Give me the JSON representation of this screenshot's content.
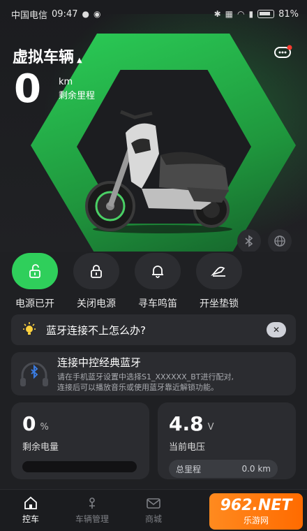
{
  "status_bar": {
    "carrier": "中国电信",
    "time": "09:47",
    "battery": "81%"
  },
  "vehicle": {
    "name": "虚拟车辆",
    "range_value": "0",
    "range_unit": "km",
    "range_label": "剩余里程"
  },
  "controls": [
    {
      "label": "电源已开",
      "icon": "unlock-icon",
      "active": true
    },
    {
      "label": "关闭电源",
      "icon": "lock-icon",
      "active": false
    },
    {
      "label": "寻车鸣笛",
      "icon": "bell-icon",
      "active": false
    },
    {
      "label": "开坐垫锁",
      "icon": "seat-icon",
      "active": false
    }
  ],
  "tip": {
    "text": "蓝牙连接不上怎么办?"
  },
  "bluetooth_card": {
    "title": "连接中控经典蓝牙",
    "desc_line1": "请在手机蓝牙设置中选择S1_XXXXXX_BT进行配对,",
    "desc_line2": "连接后可以播放音乐或使用蓝牙靠近解锁功能。"
  },
  "battery_card": {
    "value": "0",
    "unit": "%",
    "label": "剩余电量",
    "level": 0
  },
  "voltage_card": {
    "value": "4.8",
    "unit": "V",
    "label": "当前电压",
    "mileage_label": "总里程",
    "mileage_value": "0.0 km"
  },
  "tabs": [
    {
      "label": "控车",
      "icon": "home-icon",
      "active": true
    },
    {
      "label": "车辆管理",
      "icon": "scooter-icon",
      "active": false
    },
    {
      "label": "商城",
      "icon": "mail-icon",
      "active": false
    }
  ],
  "watermark": {
    "main": "962.NET",
    "sub": "乐游网"
  },
  "colors": {
    "accent": "#2fcf5b",
    "background": "#1f2023",
    "card": "#2b2c30"
  }
}
